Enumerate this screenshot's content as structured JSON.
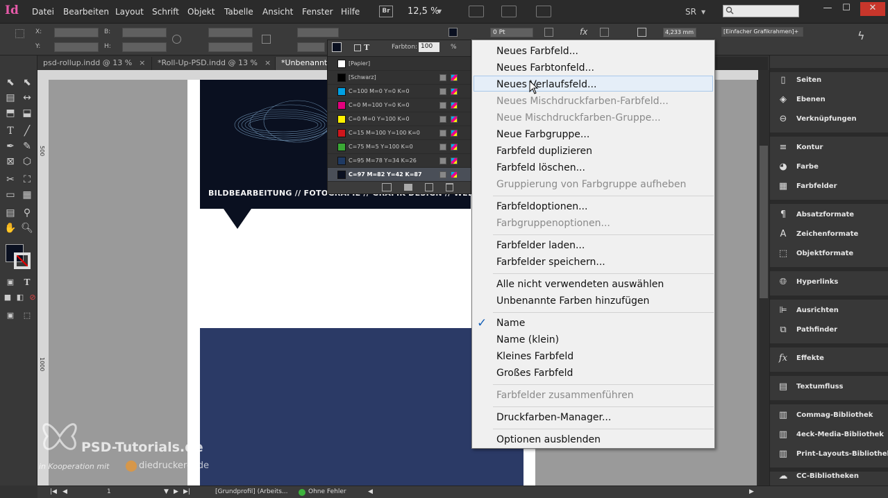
{
  "app": {
    "logo": "Id"
  },
  "menubar": {
    "items": [
      "Datei",
      "Bearbeiten",
      "Layout",
      "Schrift",
      "Objekt",
      "Tabelle",
      "Ansicht",
      "Fenster",
      "Hilfe"
    ],
    "bridge_badge": "Br",
    "zoom": "12,5 %",
    "workspace": "SR"
  },
  "controlbar": {
    "x_label": "X:",
    "y_label": "Y:",
    "w_label": "B:",
    "h_label": "H:",
    "stroke_weight": "0 Pt",
    "size_value": "4,233 mm",
    "frame_style": "[Einfacher Grafikrahmen]+"
  },
  "tabs": [
    {
      "label": "psd-rollup.indd @ 13 %",
      "close": "×"
    },
    {
      "label": "*Roll-Up-PSD.indd @ 13 %",
      "close": "×"
    },
    {
      "label": "*Unbenannt-",
      "close": ""
    }
  ],
  "rulers": {
    "v_ticks": [
      "500",
      "1000"
    ]
  },
  "document": {
    "banner_text": "BILDBEARBEITUNG // FOTOGRAFIE // GRAFIK-DESIGN // WEBENT"
  },
  "watermark": {
    "main": "PSD-Tutorials.de",
    "sub": "in Kooperation mit",
    "brand": "diedruckerei.de"
  },
  "swatches": {
    "tint_label": "Farbton:",
    "tint_value": "100",
    "tint_unit": "%",
    "rows": [
      {
        "name": "[Papier]",
        "color": "#ffffff"
      },
      {
        "name": "[Schwarz]",
        "color": "#000000"
      },
      {
        "name": "C=100 M=0 Y=0 K=0",
        "color": "#00a0e3"
      },
      {
        "name": "C=0 M=100 Y=0 K=0",
        "color": "#e4007d"
      },
      {
        "name": "C=0 M=0 Y=100 K=0",
        "color": "#fff100"
      },
      {
        "name": "C=15 M=100 Y=100 K=0",
        "color": "#d0161c"
      },
      {
        "name": "C=75 M=5 Y=100 K=0",
        "color": "#3aa935"
      },
      {
        "name": "C=95 M=78 Y=34 K=26",
        "color": "#1f3a63"
      },
      {
        "name": "C=97 M=82 Y=42 K=87",
        "color": "#0a1020"
      }
    ]
  },
  "dropdown": {
    "items": [
      {
        "label": "Neues Farbfeld...",
        "disabled": false
      },
      {
        "label": "Neues Farbtonfeld...",
        "disabled": false
      },
      {
        "label": "Neues Verlaufsfeld...",
        "disabled": false
      },
      {
        "label": "Neues Mischdruckfarben-Farbfeld...",
        "disabled": true
      },
      {
        "label": "Neue Mischdruckfarben-Gruppe...",
        "disabled": true
      },
      {
        "label": "Neue Farbgruppe...",
        "disabled": false
      },
      {
        "label": "Farbfeld duplizieren",
        "disabled": false
      },
      {
        "label": "Farbfeld löschen...",
        "disabled": false
      },
      {
        "label": "Gruppierung von Farbgruppe aufheben",
        "disabled": true
      },
      {
        "label": "Farbfeldoptionen...",
        "disabled": false
      },
      {
        "label": "Farbgruppenoptionen...",
        "disabled": true
      },
      {
        "label": "Farbfelder laden...",
        "disabled": false
      },
      {
        "label": "Farbfelder speichern...",
        "disabled": false
      },
      {
        "label": "Alle nicht verwendeten auswählen",
        "disabled": false
      },
      {
        "label": "Unbenannte Farben hinzufügen",
        "disabled": false
      },
      {
        "label": "Name",
        "disabled": false
      },
      {
        "label": "Name (klein)",
        "disabled": false
      },
      {
        "label": "Kleines Farbfeld",
        "disabled": false
      },
      {
        "label": "Großes Farbfeld",
        "disabled": false
      },
      {
        "label": "Farbfelder zusammenführen",
        "disabled": true
      },
      {
        "label": "Druckfarben-Manager...",
        "disabled": false
      },
      {
        "label": "Optionen ausblenden",
        "disabled": false
      }
    ],
    "check": "✓"
  },
  "rightpanel": {
    "items": [
      {
        "label": "Seiten",
        "icon": "pages-icon"
      },
      {
        "label": "Ebenen",
        "icon": "layers-icon"
      },
      {
        "label": "Verknüpfungen",
        "icon": "links-icon"
      },
      {
        "label": "Kontur",
        "icon": "stroke-icon"
      },
      {
        "label": "Farbe",
        "icon": "color-icon"
      },
      {
        "label": "Farbfelder",
        "icon": "swatches-icon"
      },
      {
        "label": "Absatzformate",
        "icon": "paragraph-styles-icon"
      },
      {
        "label": "Zeichenformate",
        "icon": "character-styles-icon"
      },
      {
        "label": "Objektformate",
        "icon": "object-styles-icon"
      },
      {
        "label": "Hyperlinks",
        "icon": "hyperlinks-icon"
      },
      {
        "label": "Ausrichten",
        "icon": "align-icon"
      },
      {
        "label": "Pathfinder",
        "icon": "pathfinder-icon"
      },
      {
        "label": "Effekte",
        "icon": "effects-icon"
      },
      {
        "label": "Textumfluss",
        "icon": "text-wrap-icon"
      },
      {
        "label": "Commag-Bibliothek",
        "icon": "library-icon"
      },
      {
        "label": "4eck-Media-Bibliothek",
        "icon": "library-icon"
      },
      {
        "label": "Print-Layouts-Bibliothek",
        "icon": "library-icon"
      },
      {
        "label": "CC-Bibliotheken",
        "icon": "cc-libraries-icon"
      }
    ]
  },
  "statusbar": {
    "page": "1",
    "profile": "[Grundprofil] (Arbeits...",
    "preflight": "Ohne Fehler"
  }
}
